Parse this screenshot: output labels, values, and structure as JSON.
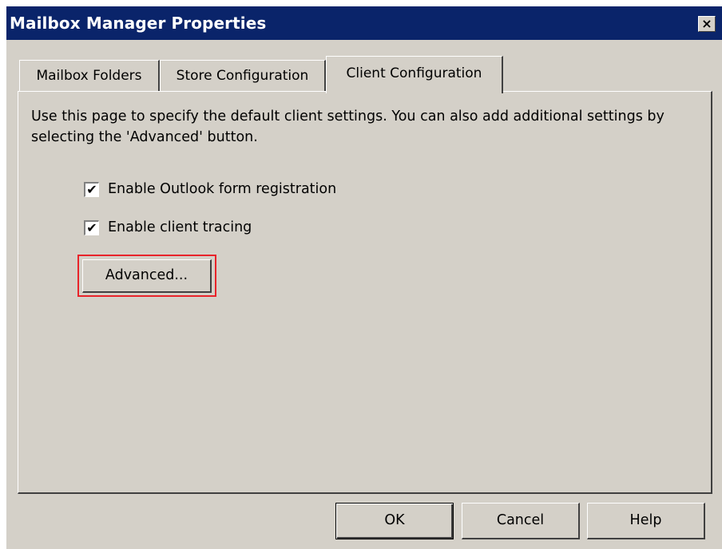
{
  "window": {
    "title": "Mailbox Manager Properties",
    "close_glyph": "×"
  },
  "tabs": [
    {
      "label": "Mailbox Folders",
      "selected": false
    },
    {
      "label": "Store Configuration",
      "selected": false
    },
    {
      "label": "Client Configuration",
      "selected": true
    }
  ],
  "panel": {
    "description": "Use this page to specify the default client settings. You can also add additional settings by selecting the 'Advanced' button.",
    "checkboxes": [
      {
        "label": "Enable Outlook form registration",
        "checked": true,
        "mark": "✔"
      },
      {
        "label": "Enable client tracing",
        "checked": true,
        "mark": "✔"
      }
    ],
    "advanced_button": "Advanced..."
  },
  "buttons": {
    "ok": "OK",
    "cancel": "Cancel",
    "help": "Help"
  },
  "colors": {
    "titlebar": "#0a246a",
    "face": "#d4d0c8",
    "highlight": "#e8232a"
  }
}
